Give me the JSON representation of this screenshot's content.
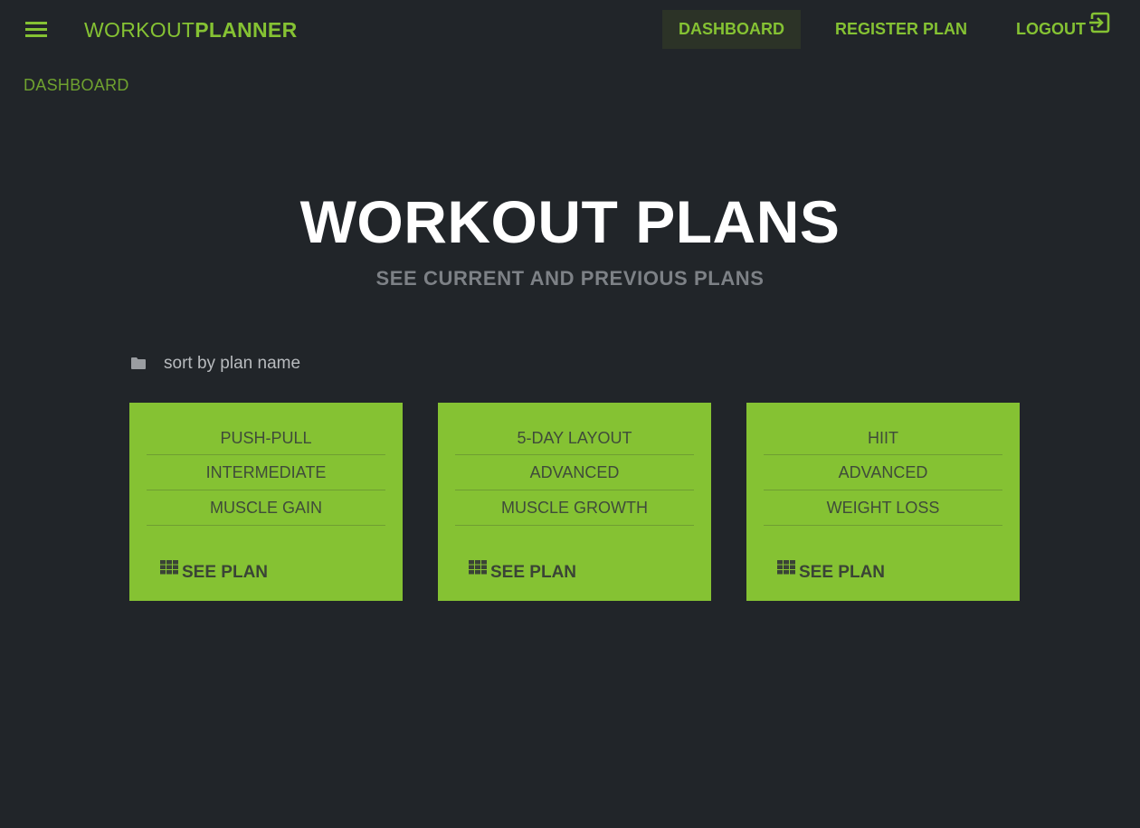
{
  "nav": {
    "brand_light": "WORKOUT",
    "brand_bold": "PLANNER",
    "links": {
      "dashboard": "DASHBOARD",
      "register": "REGISTER PLAN",
      "logout": "LOGOUT"
    },
    "accent_color": "#85c233",
    "menu_icon": "hamburger-menu-icon",
    "logout_icon": "exit-to-app-icon"
  },
  "breadcrumb": "DASHBOARD",
  "header": {
    "title": "WORKOUT PLANS",
    "subtitle": "SEE CURRENT AND PREVIOUS PLANS"
  },
  "sort": {
    "icon": "folder-icon",
    "label": "sort by plan name"
  },
  "plans": [
    {
      "name": "PUSH-PULL",
      "level": "INTERMEDIATE",
      "goal": "MUSCLE GAIN",
      "action_label": "SEE PLAN",
      "action_icon": "grid-icon"
    },
    {
      "name": "5-DAY LAYOUT",
      "level": "ADVANCED",
      "goal": "MUSCLE GROWTH",
      "action_label": "SEE PLAN",
      "action_icon": "grid-icon"
    },
    {
      "name": "HIIT",
      "level": "ADVANCED",
      "goal": "WEIGHT LOSS",
      "action_label": "SEE PLAN",
      "action_icon": "grid-icon"
    }
  ],
  "colors": {
    "background": "#212529",
    "card": "#85c233",
    "card_text": "#3f4b3a"
  }
}
